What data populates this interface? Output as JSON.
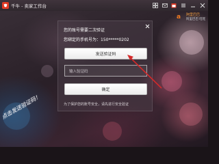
{
  "window": {
    "title": "千牛 - 卖家工作台"
  },
  "titlebar_icons": [
    "grid-icon",
    "mail-icon",
    "calendar-icon",
    "menu-icon",
    "minimize-icon",
    "close-icon"
  ],
  "brand": {
    "mark": "a",
    "name": "阿里巴巴",
    "subtitle": "阿里巴巴 旺旺"
  },
  "dialog": {
    "title": "您的账号需要二次验证",
    "phone_text": "您绑定的手机号为：150*****0202",
    "send_code_label": "发送验证码",
    "code_placeholder": "输入验证码",
    "confirm_label": "确定",
    "note": "为了保护您的账号安全，请先进行安全验证"
  },
  "annotation": {
    "note": "点击发送验证码！",
    "color": "#d42a2a"
  },
  "colors": {
    "logo_red": "#e23a25",
    "brand_orange": "#f07a20",
    "arrow_red": "#d42a2a"
  }
}
